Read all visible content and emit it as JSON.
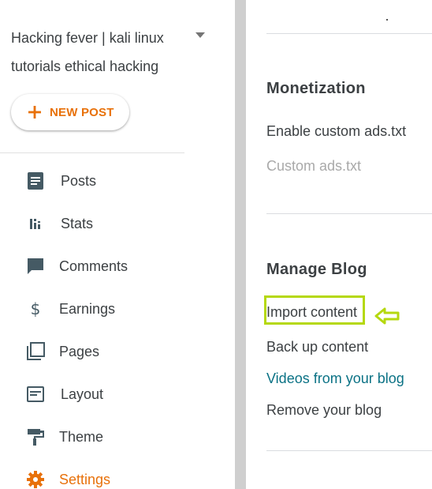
{
  "sidebar": {
    "blog_title_line1": "Hacking fever | kali linux",
    "blog_title_line2": "tutorials ethical hacking",
    "new_post_label": "NEW POST",
    "items": [
      {
        "label": "Posts",
        "icon": "posts-icon"
      },
      {
        "label": "Stats",
        "icon": "stats-icon"
      },
      {
        "label": "Comments",
        "icon": "comment-icon"
      },
      {
        "label": "Earnings",
        "icon": "dollar-icon"
      },
      {
        "label": "Pages",
        "icon": "pages-icon"
      },
      {
        "label": "Layout",
        "icon": "layout-icon"
      },
      {
        "label": "Theme",
        "icon": "paint-roller-icon"
      },
      {
        "label": "Settings",
        "icon": "gear-icon",
        "active": true
      }
    ]
  },
  "main": {
    "monetization": {
      "title": "Monetization",
      "enable_ads_txt": "Enable custom ads.txt",
      "custom_ads_txt": "Custom ads.txt"
    },
    "manage_blog": {
      "title": "Manage Blog",
      "import_content": "Import content",
      "back_up_content": "Back up content",
      "videos_from_blog": "Videos from your blog",
      "remove_blog": "Remove your blog"
    }
  },
  "colors": {
    "accent_orange": "#e8710a",
    "icon_gray": "#455a64",
    "link_teal": "#0b7285",
    "highlight_green": "#b5d80f"
  }
}
